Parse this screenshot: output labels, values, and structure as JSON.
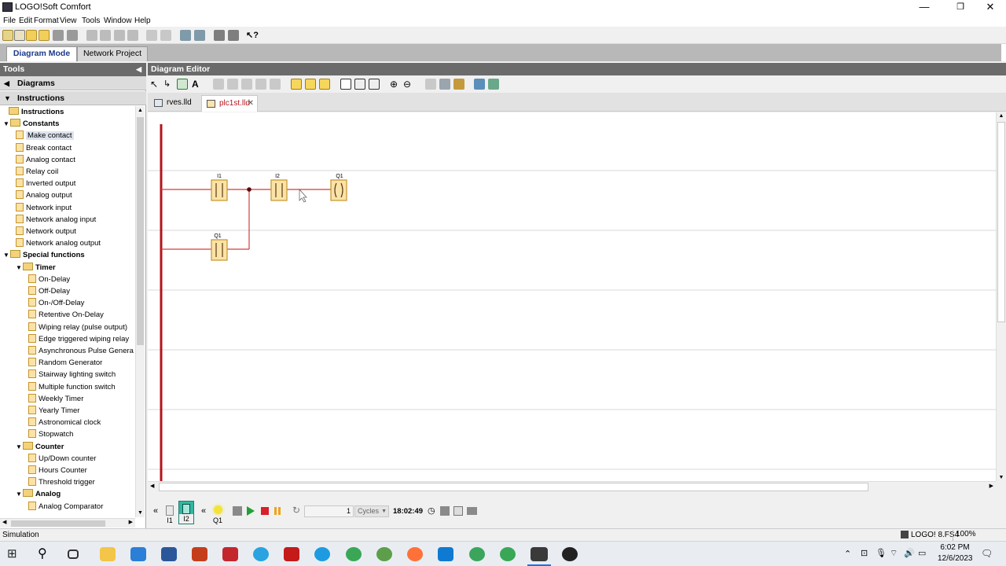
{
  "window": {
    "title": "LOGO!Soft Comfort",
    "minimize": "—",
    "maximize": "❐",
    "close": "✕"
  },
  "menu": [
    "File",
    "Edit",
    "Format",
    "View",
    "Tools",
    "Window",
    "Help"
  ],
  "modes": {
    "diagram": "Diagram Mode",
    "network": "Network Project"
  },
  "tools_panel": {
    "header": "Tools",
    "sections": {
      "diagrams": "Diagrams",
      "instructions": "Instructions"
    },
    "tree": [
      {
        "label": "Instructions",
        "kind": "folder",
        "level": 0,
        "bold": true
      },
      {
        "label": "Constants",
        "kind": "folder",
        "level": 1,
        "bold": true,
        "expanded": true
      },
      {
        "label": "Make contact",
        "kind": "item",
        "level": 2,
        "selected": true
      },
      {
        "label": "Break contact",
        "kind": "item",
        "level": 2
      },
      {
        "label": "Analog contact",
        "kind": "item",
        "level": 2
      },
      {
        "label": "Relay coil",
        "kind": "item",
        "level": 2
      },
      {
        "label": "Inverted output",
        "kind": "item",
        "level": 2
      },
      {
        "label": "Analog output",
        "kind": "item",
        "level": 2
      },
      {
        "label": "Network input",
        "kind": "item",
        "level": 2
      },
      {
        "label": "Network analog input",
        "kind": "item",
        "level": 2
      },
      {
        "label": "Network output",
        "kind": "item",
        "level": 2
      },
      {
        "label": "Network analog output",
        "kind": "item",
        "level": 2
      },
      {
        "label": "Special functions",
        "kind": "folder",
        "level": 1,
        "bold": true,
        "expanded": true
      },
      {
        "label": "Timer",
        "kind": "folder",
        "level": 2,
        "bold": true,
        "expanded": true
      },
      {
        "label": "On-Delay",
        "kind": "item",
        "level": 3
      },
      {
        "label": "Off-Delay",
        "kind": "item",
        "level": 3
      },
      {
        "label": "On-/Off-Delay",
        "kind": "item",
        "level": 3
      },
      {
        "label": "Retentive On-Delay",
        "kind": "item",
        "level": 3
      },
      {
        "label": "Wiping relay (pulse output)",
        "kind": "item",
        "level": 3
      },
      {
        "label": "Edge triggered wiping relay",
        "kind": "item",
        "level": 3
      },
      {
        "label": "Asynchronous Pulse Generat",
        "kind": "item",
        "level": 3
      },
      {
        "label": "Random Generator",
        "kind": "item",
        "level": 3
      },
      {
        "label": "Stairway lighting switch",
        "kind": "item",
        "level": 3
      },
      {
        "label": "Multiple function switch",
        "kind": "item",
        "level": 3
      },
      {
        "label": "Weekly Timer",
        "kind": "item",
        "level": 3
      },
      {
        "label": "Yearly Timer",
        "kind": "item",
        "level": 3
      },
      {
        "label": "Astronomical clock",
        "kind": "item",
        "level": 3
      },
      {
        "label": "Stopwatch",
        "kind": "item",
        "level": 3
      },
      {
        "label": "Counter",
        "kind": "folder",
        "level": 2,
        "bold": true,
        "expanded": true
      },
      {
        "label": "Up/Down counter",
        "kind": "item",
        "level": 3
      },
      {
        "label": "Hours Counter",
        "kind": "item",
        "level": 3
      },
      {
        "label": "Threshold trigger",
        "kind": "item",
        "level": 3
      },
      {
        "label": "Analog",
        "kind": "folder",
        "level": 2,
        "bold": true,
        "expanded": true
      },
      {
        "label": "Analog Comparator",
        "kind": "item",
        "level": 3
      }
    ]
  },
  "editor": {
    "header": "Diagram Editor",
    "tabs": [
      {
        "label": "rves.lld",
        "active": false,
        "closable": false
      },
      {
        "label": "plc1st.lld",
        "active": true,
        "closable": true
      }
    ],
    "ladder": {
      "labels": {
        "i1": "I1",
        "i2": "I2",
        "q1_coil": "Q1",
        "q1_contact": "Q1"
      }
    }
  },
  "simulation": {
    "inputs": [
      {
        "label": "I1"
      },
      {
        "label": "I2"
      }
    ],
    "outputs": [
      {
        "label": "Q1"
      }
    ],
    "cycles_value": "1",
    "cycles_unit": "Cycles",
    "time": "18:02:49"
  },
  "statusbar": {
    "left": "Simulation",
    "device": "LOGO! 8.FS4",
    "zoom": "100%"
  },
  "taskbar": {
    "time": "6:02 PM",
    "date": "12/6/2023"
  },
  "colors": {
    "rail": "#b2151d",
    "wire": "#d63b3b",
    "block_fill": "#fbe3a8",
    "block_border": "#c6942a",
    "panel_header": "#6b6b6b"
  }
}
